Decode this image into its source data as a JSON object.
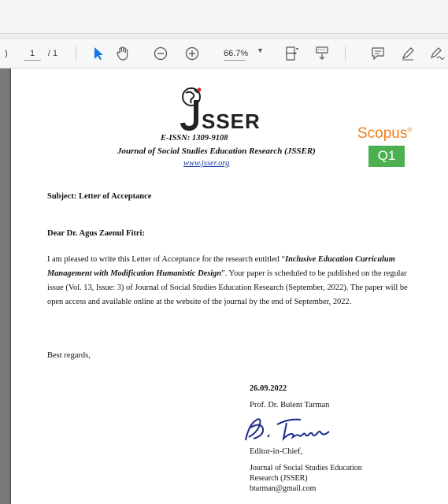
{
  "toolbar": {
    "current_page": "1",
    "total_pages": "/ 1",
    "zoom": "66.7%"
  },
  "header": {
    "logo_text": "SSER",
    "issn": "E-ISSN: 1309-9108",
    "journal_name": "Journal of Social Studies Education Research (JSSER)",
    "website": "www.jsser.org",
    "scopus_label": "Scopus",
    "quartile": "Q1"
  },
  "letter": {
    "subject": "Subject: Letter of Acceptance",
    "salutation": "Dear Dr. Agus Zaenul Fitri:",
    "p1": "I am pleased to write this Letter of Acceptance for the research entitled “",
    "title": "Inclusive Education Curriculum Management with Modification Humanistic Design",
    "p2": "”. Your paper is scheduled to be published on the regular issue (Vol. 13, Issue: 3) of Journal of Social Studies Education Research (September, 2022). The paper will be open access and available online at the website of the journal by the end of September, 2022.",
    "closing": "Best regards,",
    "date": "26.09.2022",
    "signer": "Prof. Dr. Bulent Tarman",
    "role": "Editor-in-Chief,",
    "org1": "Journal of Social Studies Education",
    "org2": "Research (JSSER)",
    "email": "btarman@gmail.com"
  },
  "colors": {
    "scopus_orange": "#f07f1a",
    "q1_green": "#4caf50",
    "link_blue": "#1a3aa8",
    "cursor_blue": "#1473e6"
  }
}
